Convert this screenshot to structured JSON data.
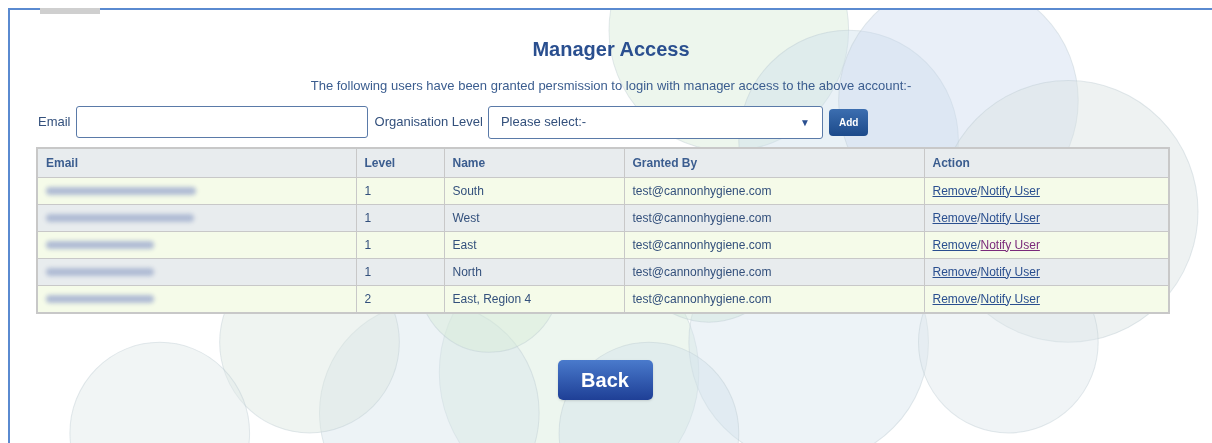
{
  "title": "Manager Access",
  "intro": "The following users have been granted persmission to login with manager access to the above account:-",
  "form": {
    "email_label": "Email",
    "level_label": "Organisation Level",
    "level_select": {
      "value": "Please select:-",
      "arrow": "▼"
    },
    "add_button": "Add"
  },
  "table": {
    "columns": [
      "Email",
      "Level",
      "Name",
      "Granted By",
      "Action"
    ],
    "rows": [
      {
        "level": "1",
        "name": "South",
        "granted_by": "test@cannonhygiene.com",
        "remove": "Remove",
        "separator": "/",
        "notify": "Notify User",
        "notify_visited": false
      },
      {
        "level": "1",
        "name": "West",
        "granted_by": "test@cannonhygiene.com",
        "remove": "Remove",
        "separator": "/",
        "notify": "Notify User",
        "notify_visited": false
      },
      {
        "level": "1",
        "name": "East",
        "granted_by": "test@cannonhygiene.com",
        "remove": "Remove",
        "separator": "/",
        "notify": "Notify User",
        "notify_visited": true
      },
      {
        "level": "1",
        "name": "North",
        "granted_by": "test@cannonhygiene.com",
        "remove": "Remove",
        "separator": "/",
        "notify": "Notify User",
        "notify_visited": false
      },
      {
        "level": "2",
        "name": "East, Region 4",
        "granted_by": "test@cannonhygiene.com",
        "remove": "Remove",
        "separator": "/",
        "notify": "Notify User",
        "notify_visited": false
      }
    ]
  },
  "back_button": "Back"
}
